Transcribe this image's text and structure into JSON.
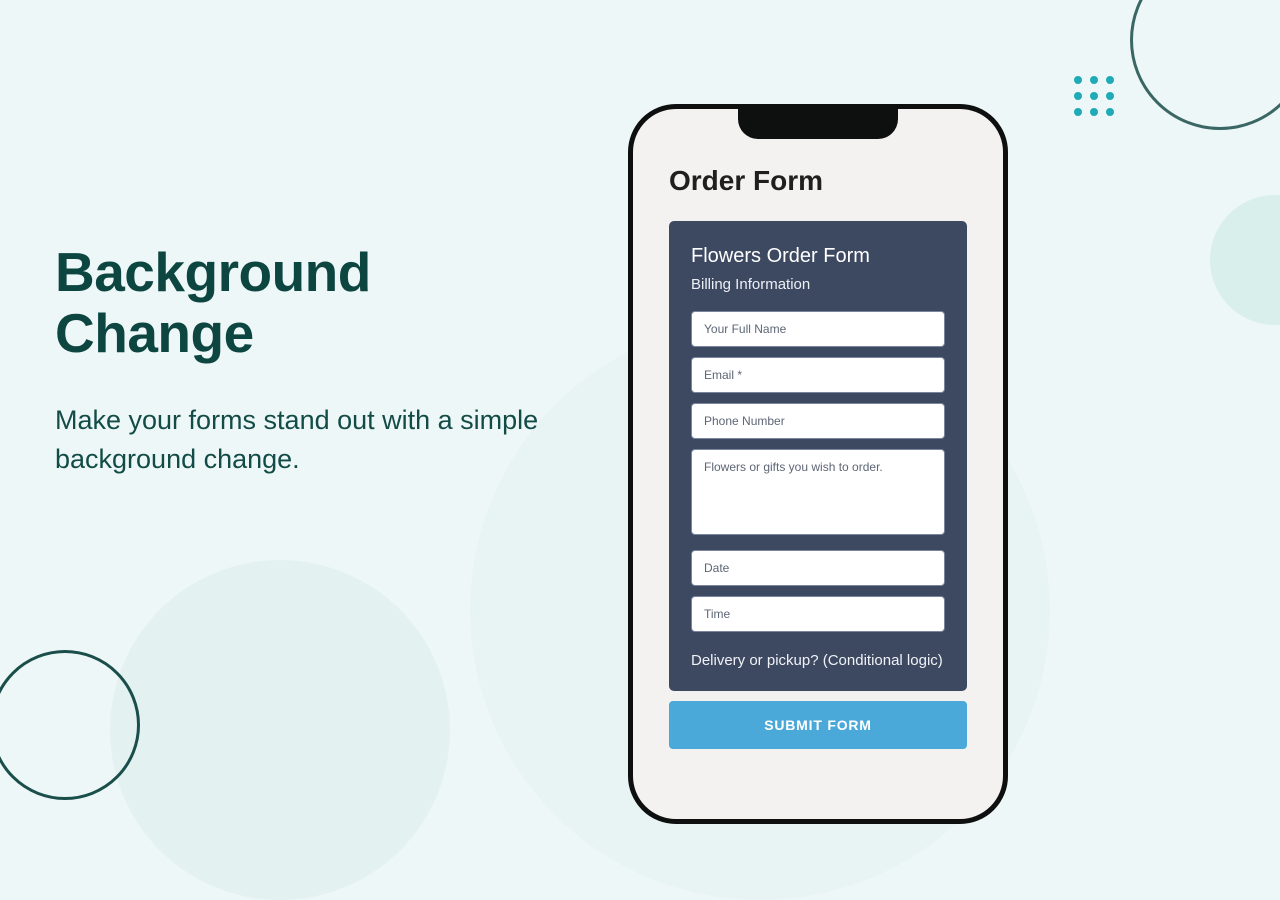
{
  "hero": {
    "heading_line1": "Background",
    "heading_line2": "Change",
    "subtext": "Make your forms stand out with a simple background change."
  },
  "phone": {
    "page_title": "Order Form",
    "form": {
      "title": "Flowers Order Form",
      "subtitle": "Billing Information",
      "fields": {
        "full_name_placeholder": "Your Full Name",
        "email_placeholder": "Email *",
        "phone_placeholder": "Phone Number",
        "order_placeholder": "Flowers or gifts you wish to order.",
        "date_placeholder": "Date",
        "time_placeholder": "Time"
      },
      "conditional_label": "Delivery or pickup? (Conditional logic)",
      "submit_label": "SUBMIT FORM"
    }
  },
  "colors": {
    "page_bg": "#edf7f7",
    "accent_dark": "#0d4641",
    "accent_teal": "#1eabb5",
    "form_bg": "#3d4861",
    "submit_bg": "#4ba9d9"
  }
}
